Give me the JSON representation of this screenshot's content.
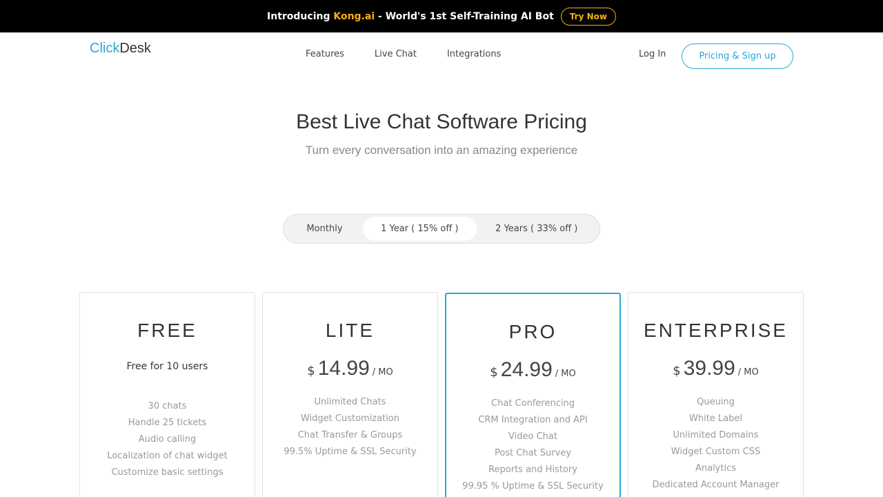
{
  "promo": {
    "intro": "Introducing",
    "brand": "Kong.ai",
    "tagline": "- World's 1st Self-Training AI Bot",
    "cta": "Try Now"
  },
  "logo": {
    "part1": "Click",
    "part2": "Desk"
  },
  "nav": {
    "items": [
      "Features",
      "Live Chat",
      "Integrations"
    ]
  },
  "header": {
    "login": "Log In",
    "signup": "Pricing & Sign up"
  },
  "hero": {
    "title": "Best Live Chat Software Pricing",
    "subtitle": "Turn every conversation into an amazing experience"
  },
  "billing": {
    "options": [
      "Monthly",
      "1 Year ( 15% off )",
      "2 Years ( 33% off )"
    ],
    "selected": "1 Year ( 15% off )"
  },
  "plans": [
    {
      "name": "FREE",
      "note": "Free for 10 users",
      "features": [
        "30 chats",
        "Handle 25 tickets",
        "Audio calling",
        "Localization of chat widget",
        "Customize basic settings"
      ]
    },
    {
      "name": "LITE",
      "currency": "$",
      "price": "14.99",
      "period": "/ MO",
      "features": [
        "Unlimited Chats",
        "Widget Customization",
        "Chat Transfer & Groups",
        "99.5% Uptime & SSL Security"
      ]
    },
    {
      "name": "PRO",
      "currency": "$",
      "price": "24.99",
      "period": "/ MO",
      "features": [
        "Chat Conferencing",
        "CRM Integration and API",
        "Video Chat",
        "Post Chat Survey",
        "Reports and History",
        "99.95 % Uptime & SSL Security"
      ]
    },
    {
      "name": "ENTERPRISE",
      "currency": "$",
      "price": "39.99",
      "period": "/ MO",
      "features": [
        "Queuing",
        "White Label",
        "Unlimited Domains",
        "Widget Custom CSS",
        "Analytics",
        "Dedicated Account Manager"
      ]
    }
  ],
  "colors": {
    "accent": "#29a7d3",
    "promo_brand": "#f6b20f"
  }
}
